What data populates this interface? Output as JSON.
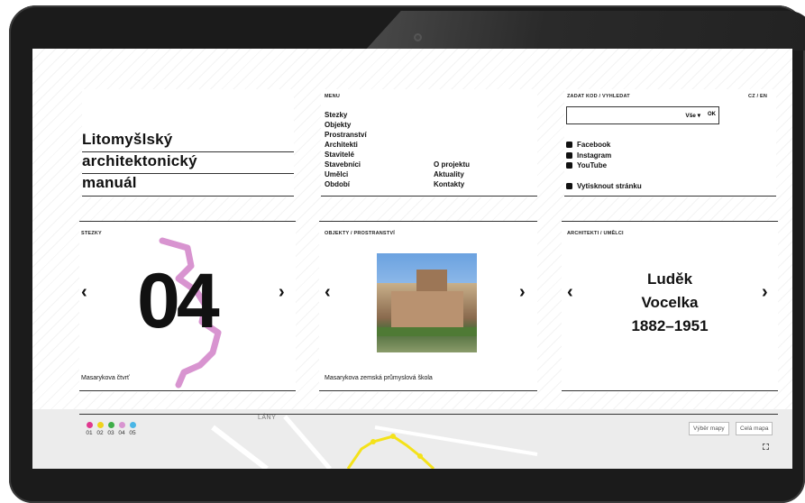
{
  "header": {
    "title_lines": [
      "Litomyšlský",
      "architektonický",
      "manuál"
    ],
    "menu_label": "MENU",
    "menu_left": [
      "Stezky",
      "Objekty",
      "Prostranství",
      "Architekti",
      "Stavitelé",
      "Stavebníci",
      "Umělci",
      "Období"
    ],
    "menu_right": [
      "O projektu",
      "Aktuality",
      "Kontakty"
    ],
    "search_label": "ZADAT KOD / VYHLEDAT",
    "lang": "CZ / EN",
    "search_filter": "Vše ▾",
    "search_ok": "OK",
    "social": [
      {
        "icon": "facebook-icon",
        "label": "Facebook"
      },
      {
        "icon": "instagram-icon",
        "label": "Instagram"
      },
      {
        "icon": "youtube-icon",
        "label": "YouTube"
      }
    ],
    "print": "Vytisknout stránku"
  },
  "panels": {
    "stezky": {
      "label": "STEZKY",
      "number": "04",
      "caption": "Masarykova čtvrť",
      "route_color": "#d894d0"
    },
    "objekty": {
      "label": "OBJEKTY / PROSTRANSTVÍ",
      "caption": "Masarykova zemská průmyslová škola"
    },
    "architekti": {
      "label": "ARCHITEKTI / UMĚLCI",
      "name_lines": [
        "Luděk",
        "Vocelka",
        "1882–1951"
      ]
    }
  },
  "map": {
    "place": "LÁNY",
    "legend": [
      {
        "num": "01",
        "color": "#e0388f"
      },
      {
        "num": "02",
        "color": "#f0d21c"
      },
      {
        "num": "03",
        "color": "#3fae49"
      },
      {
        "num": "04",
        "color": "#d894d0"
      },
      {
        "num": "05",
        "color": "#4ab6e6"
      }
    ],
    "btn_select": "Výběr mapy",
    "btn_full": "Celá mapa",
    "route_color": "#f4e21a"
  },
  "arrows": {
    "left": "‹",
    "right": "›"
  }
}
